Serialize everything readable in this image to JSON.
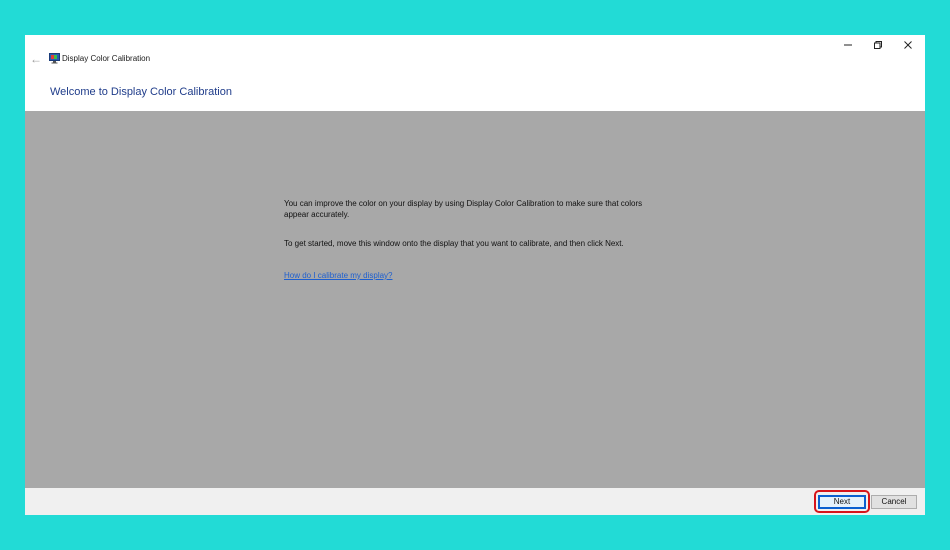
{
  "window": {
    "title": "Display Color Calibration",
    "heading": "Welcome to Display Color Calibration"
  },
  "content": {
    "paragraph1": "You can improve the color on your display by using Display Color Calibration to make sure that colors appear accurately.",
    "paragraph2": "To get started, move this window onto the display that you want to calibrate, and then click Next.",
    "help_link": "How do I calibrate my display?"
  },
  "buttons": {
    "next": "Next",
    "cancel": "Cancel"
  },
  "icons": {
    "back": "back-arrow-icon",
    "app": "display-calibration-icon",
    "minimize": "minimize-icon",
    "restore": "restore-icon",
    "close": "close-icon"
  },
  "colors": {
    "background": "#22dbd6",
    "content_gray": "#a8a8a8",
    "heading_blue": "#1f3c8a",
    "link_blue": "#1e5fcf",
    "highlight_red": "#d6141b"
  }
}
